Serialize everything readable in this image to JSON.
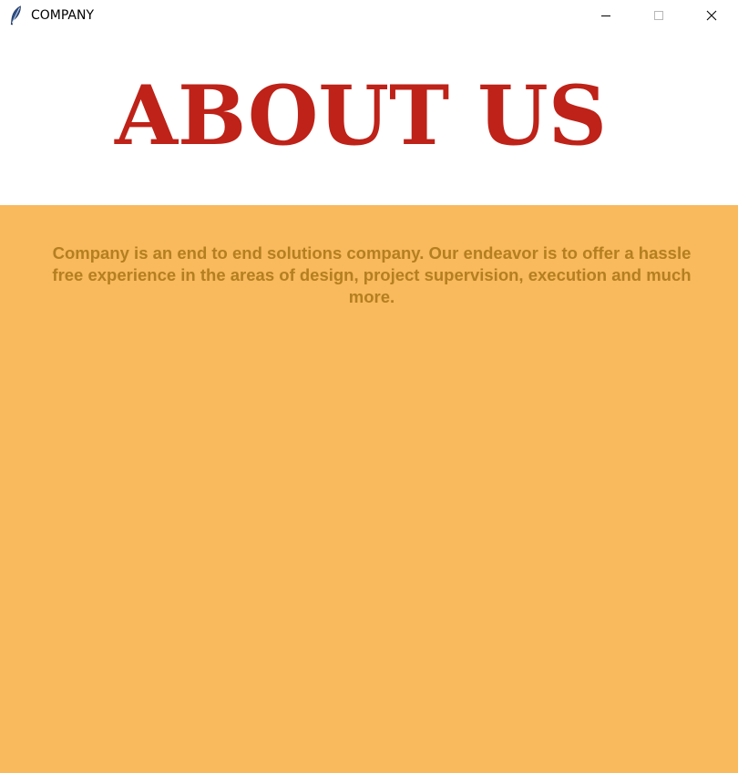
{
  "window": {
    "title": "COMPANY",
    "icon": "feather-icon",
    "controls": [
      "minimize-icon",
      "maximize-icon",
      "close-icon"
    ]
  },
  "banner": {
    "title": "ABOUT US"
  },
  "content": {
    "description": "Company is an end to end solutions company. Our endeavor is to offer a hassle free experience in the areas of design, project supervision, execution and much more."
  },
  "colors": {
    "title_red": "#be2218",
    "background_orange": "#f9b95d",
    "text_gold": "#b47f20",
    "banner_white": "#ffffff"
  }
}
